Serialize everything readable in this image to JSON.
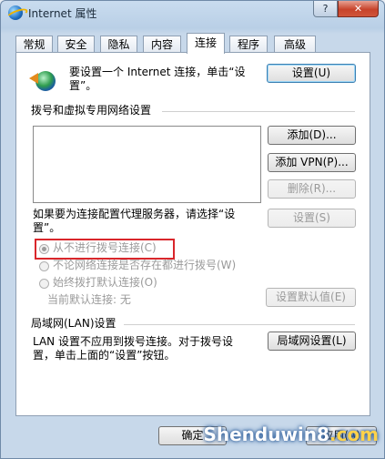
{
  "window": {
    "title": "Internet 属性",
    "help_label": "?",
    "close_label": "✕"
  },
  "tabs": [
    {
      "label": "常规"
    },
    {
      "label": "安全"
    },
    {
      "label": "隐私"
    },
    {
      "label": "内容"
    },
    {
      "label": "连接"
    },
    {
      "label": "程序"
    },
    {
      "label": "高级"
    }
  ],
  "setup": {
    "line1": "要设置一个 Internet 连接，单击“设",
    "line2": "置”。",
    "button": "设置(U)"
  },
  "dialup": {
    "heading": "拨号和虚拟专用网络设置",
    "add_button": "添加(D)...",
    "add_vpn_button": "添加 VPN(P)...",
    "remove_button": "删除(R)...",
    "proxy_line1": "如果要为连接配置代理服务器，请选择“设",
    "proxy_line2": "置”。",
    "settings_button": "设置(S)",
    "options": [
      {
        "label": "从不进行拨号连接(C)",
        "checked": true
      },
      {
        "label": "不论网络连接是否存在都进行拨号(W)",
        "checked": false
      },
      {
        "label": "始终拨打默认连接(O)",
        "checked": false
      }
    ],
    "current_default": "当前默认连接: 无",
    "set_default_button": "设置默认值(E)"
  },
  "lan": {
    "heading": "局域网(LAN)设置",
    "line1": "LAN 设置不应用到拨号连接。对于拨号设",
    "line2": "置，单击上面的“设置”按钮。",
    "button": "局域网设置(L)"
  },
  "footer": {
    "ok_button": "确定",
    "apply_button": "应用(A)"
  },
  "watermark": {
    "part1": "Shenduwin8",
    "part2": ".com"
  }
}
